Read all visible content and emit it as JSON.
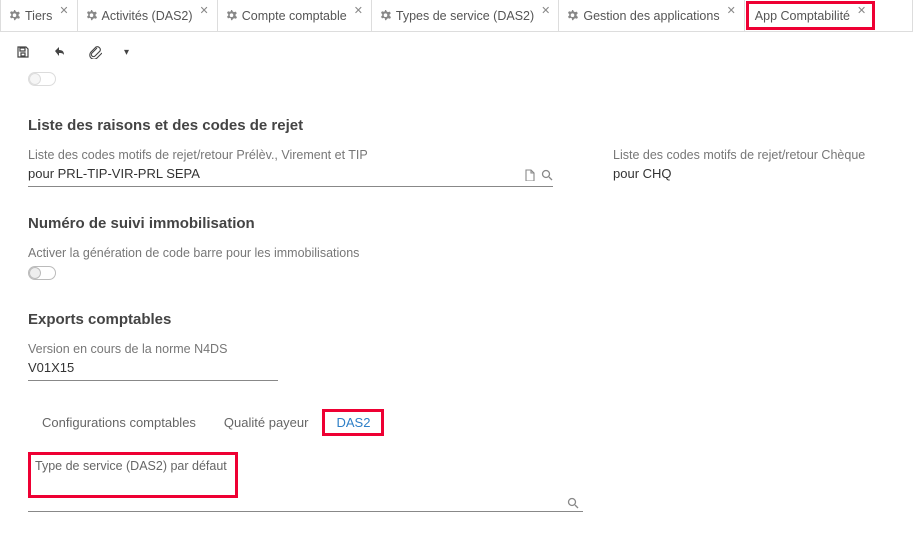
{
  "tabs": [
    {
      "label": "Tiers"
    },
    {
      "label": "Activités (DAS2)"
    },
    {
      "label": "Compte comptable"
    },
    {
      "label": "Types de service (DAS2)"
    },
    {
      "label": "Gestion des applications"
    },
    {
      "label": "App Comptabilité"
    }
  ],
  "section1": {
    "title": "Liste des raisons et des codes de rejet",
    "left_label": "Liste des codes motifs de rejet/retour Prélèv., Virement et TIP",
    "left_value": "pour PRL-TIP-VIR-PRL SEPA",
    "right_label": "Liste des codes motifs de rejet/retour Chèque",
    "right_value": "pour CHQ"
  },
  "section2": {
    "title": "Numéro de suivi immobilisation",
    "toggle_label": "Activer la génération de code barre pour les immobilisations"
  },
  "section3": {
    "title": "Exports comptables",
    "left_label": "Version en cours de la norme N4DS",
    "left_value": "V01X15"
  },
  "subtabs": [
    {
      "label": "Configurations comptables"
    },
    {
      "label": "Qualité payeur"
    },
    {
      "label": "DAS2"
    }
  ],
  "das2": {
    "default_label": "Type de service (DAS2) par défaut"
  }
}
